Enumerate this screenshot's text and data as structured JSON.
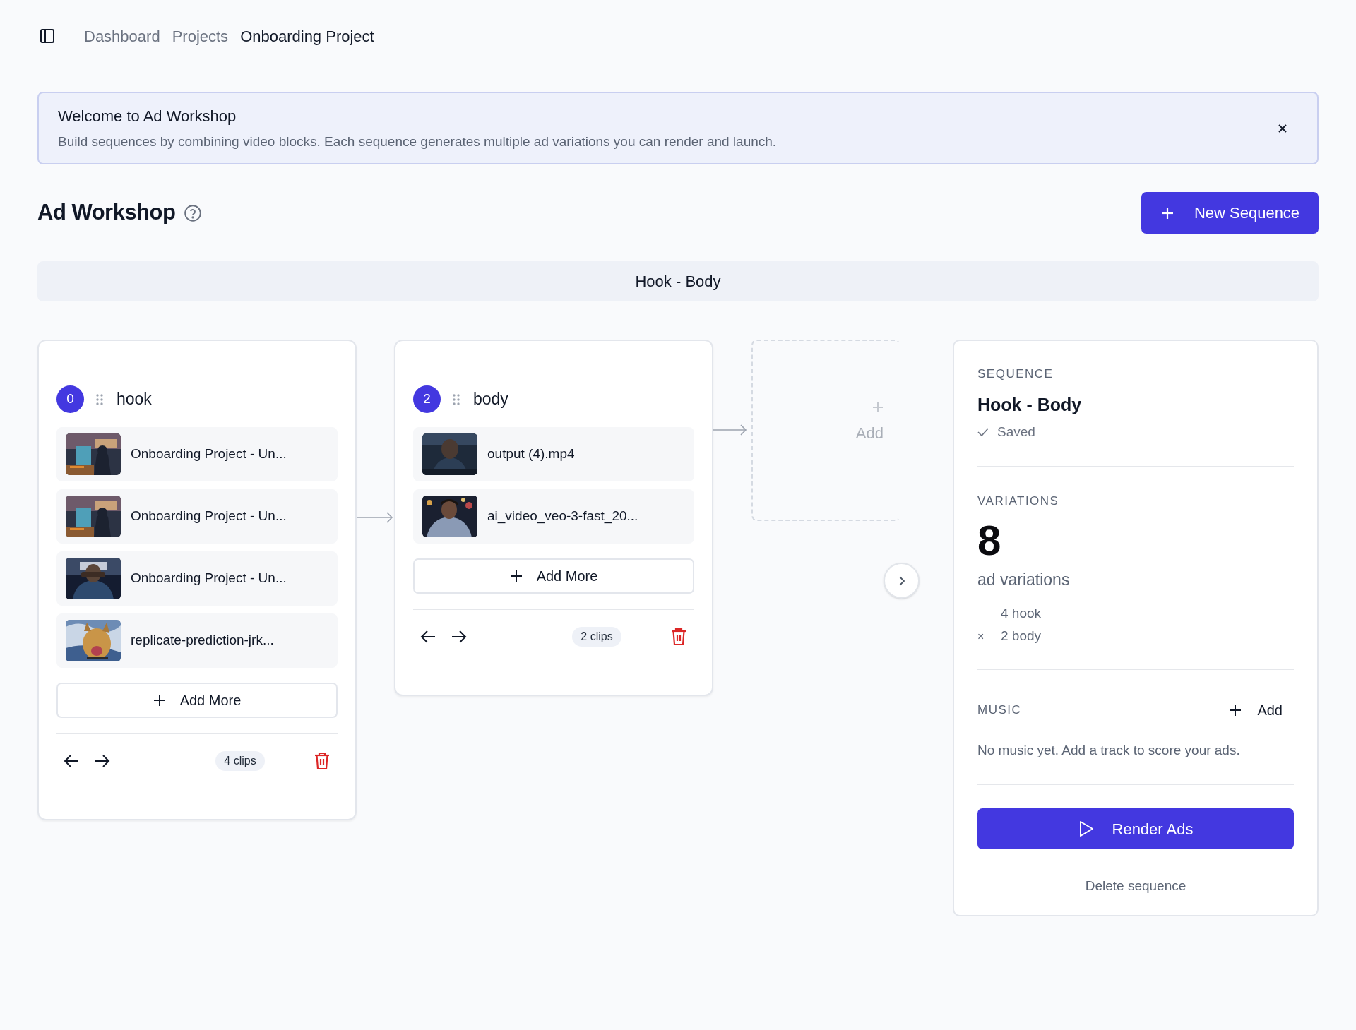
{
  "breadcrumbs": [
    {
      "label": "Dashboard",
      "current": false
    },
    {
      "label": "Projects",
      "current": false
    },
    {
      "label": "Onboarding Project",
      "current": true
    }
  ],
  "banner": {
    "title": "Welcome to Ad Workshop",
    "text": "Build sequences by combining video blocks. Each sequence generates multiple ad variations you can render and launch."
  },
  "heading": {
    "title": "Ad Workshop",
    "new_button": "New Sequence"
  },
  "sequence_tabs": [
    {
      "label": "Hook - Body",
      "selected": true
    }
  ],
  "blocks": [
    {
      "number": "0",
      "name": "hook",
      "add_button": "Add More",
      "count": "4 clips",
      "clips": [
        {
          "name": "Onboarding Project - Un..."
        },
        {
          "name": "Onboarding Project - Un..."
        },
        {
          "name": "Onboarding Project - Un..."
        },
        {
          "name": "replicate-prediction-jrk..."
        }
      ]
    },
    {
      "number": "2",
      "name": "body",
      "add_button": "Add More",
      "count": "2 clips",
      "clips": [
        {
          "name": "output (4).mp4"
        },
        {
          "name": "ai_video_veo-3-fast_20..."
        }
      ]
    }
  ],
  "add_block": {
    "label": "Add"
  },
  "panel": {
    "section_label": "SEQUENCE",
    "title": "Hook - Body",
    "status": "Saved",
    "variations_label": "VARIATIONS",
    "variations_count": "8",
    "variations_caption": "ad variations",
    "breakdown": [
      {
        "text": "4 hook"
      },
      {
        "operator": "×",
        "text": "2 body"
      }
    ],
    "music_label": "MUSIC",
    "music_add": "Add",
    "music_empty": "No music yet. Add a track to score your ads.",
    "render_button": "Render Ads",
    "delete_link": "Delete sequence"
  }
}
